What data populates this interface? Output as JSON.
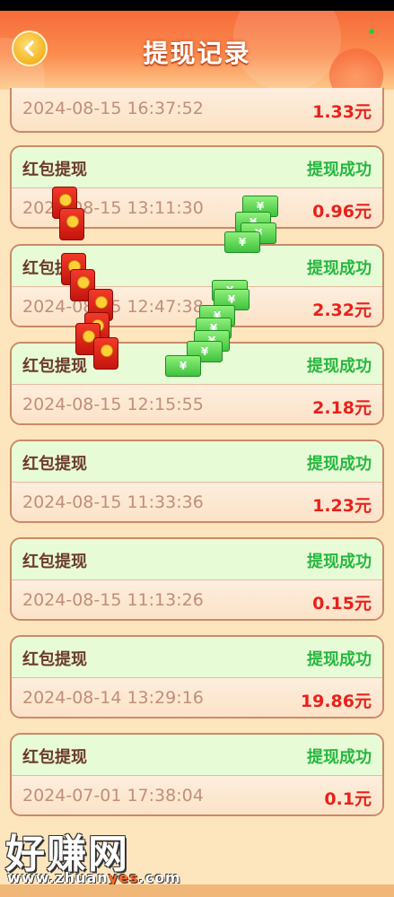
{
  "header": {
    "title": "提现记录",
    "back_icon": "chevron-left-icon"
  },
  "partial_record": {
    "datetime": "2024-08-15 16:37:52",
    "amount": "1.33元"
  },
  "records": [
    {
      "label": "红包提现",
      "status": "提现成功",
      "datetime": "2024-08-15 13:11:30",
      "amount": "0.96元"
    },
    {
      "label": "红包提现",
      "status": "提现成功",
      "datetime": "2024-08-15 12:47:38",
      "amount": "2.32元"
    },
    {
      "label": "红包提现",
      "status": "提现成功",
      "datetime": "2024-08-15 12:15:55",
      "amount": "2.18元"
    },
    {
      "label": "红包提现",
      "status": "提现成功",
      "datetime": "2024-08-15 11:33:36",
      "amount": "1.23元"
    },
    {
      "label": "红包提现",
      "status": "提现成功",
      "datetime": "2024-08-15 11:13:26",
      "amount": "0.15元"
    },
    {
      "label": "红包提现",
      "status": "提现成功",
      "datetime": "2024-08-14 13:29:16",
      "amount": "19.86元"
    },
    {
      "label": "红包提现",
      "status": "提现成功",
      "datetime": "2024-07-01 17:38:04",
      "amount": "0.1元"
    }
  ],
  "watermark": {
    "main": "好赚网",
    "url_pre": "www.zhuan",
    "url_acc": "yes",
    "url_post": ".com"
  },
  "colors": {
    "status_green": "#26b73e",
    "amount_red": "#e8211b",
    "header_orange": "#f66b3a"
  },
  "money_symbol": "¥"
}
